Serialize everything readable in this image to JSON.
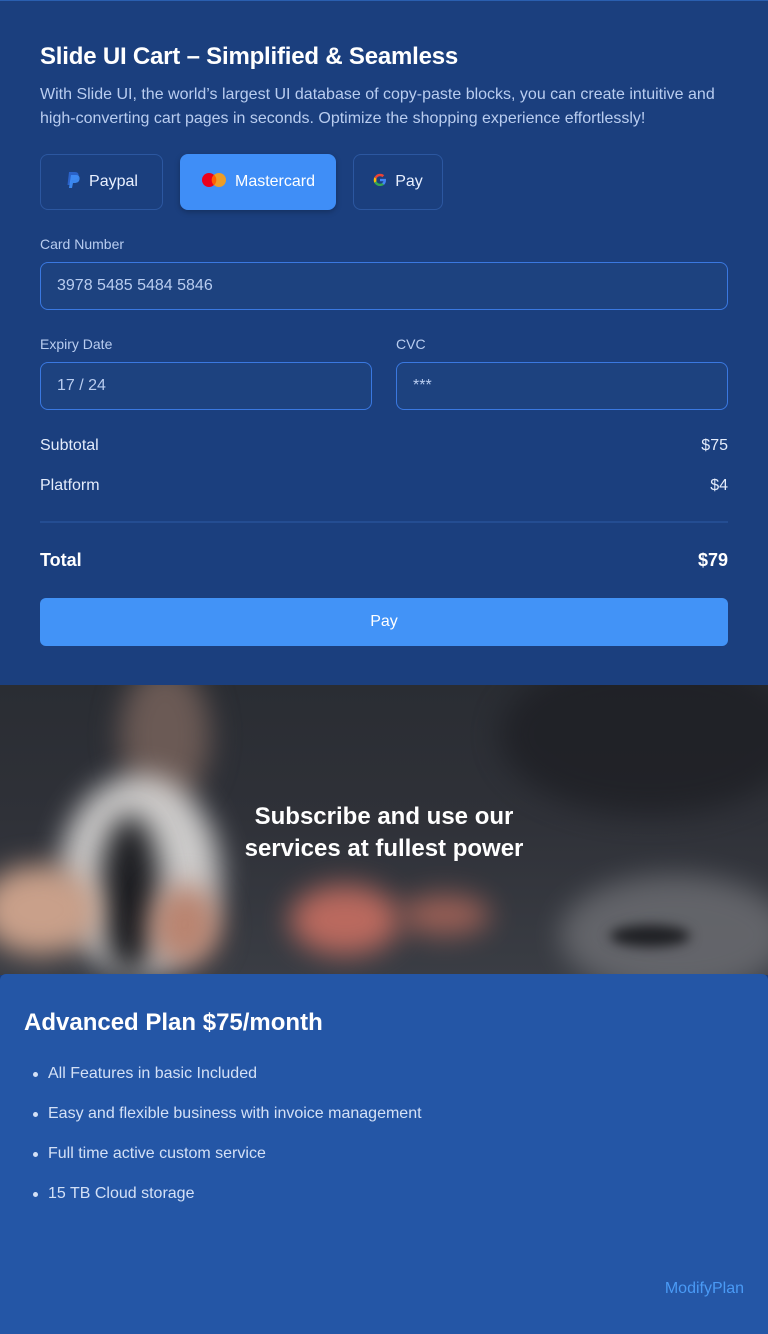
{
  "cart": {
    "title": "Slide UI Cart – Simplified & Seamless",
    "description": "With Slide UI, the world’s largest UI database of copy-paste blocks, you can create intuitive and high-converting cart pages in seconds. Optimize the shopping experience effortlessly!",
    "payment_methods": [
      {
        "label": "Paypal",
        "icon": "paypal-icon",
        "selected": false
      },
      {
        "label": "Mastercard",
        "icon": "mastercard-icon",
        "selected": true
      },
      {
        "label": "Pay",
        "icon": "google-icon",
        "selected": false
      }
    ],
    "card_number": {
      "label": "Card Number",
      "value": "3978 5485 5484 5846"
    },
    "expiry": {
      "label": "Expiry Date",
      "value": "17 / 24"
    },
    "cvc": {
      "label": "CVC",
      "value": "***"
    },
    "summary": [
      {
        "label": "Subtotal",
        "value": "$75"
      },
      {
        "label": "Platform",
        "value": "$4"
      }
    ],
    "total": {
      "label": "Total",
      "value": "$79"
    },
    "pay_button": "Pay"
  },
  "hero": {
    "title_line1": "Subscribe and use our",
    "title_line2": "services at fullest power"
  },
  "plan": {
    "title": "Advanced Plan $75/month",
    "features": [
      "All Features in basic Included",
      "Easy and flexible business with invoice management",
      "Full time active custom service",
      "15 TB Cloud storage"
    ],
    "modify_link": "ModifyPlan"
  },
  "colors": {
    "background": "#1b3f7e",
    "accent": "#4293f7",
    "plan_card": "#2456a6",
    "link": "#4a9af5"
  }
}
